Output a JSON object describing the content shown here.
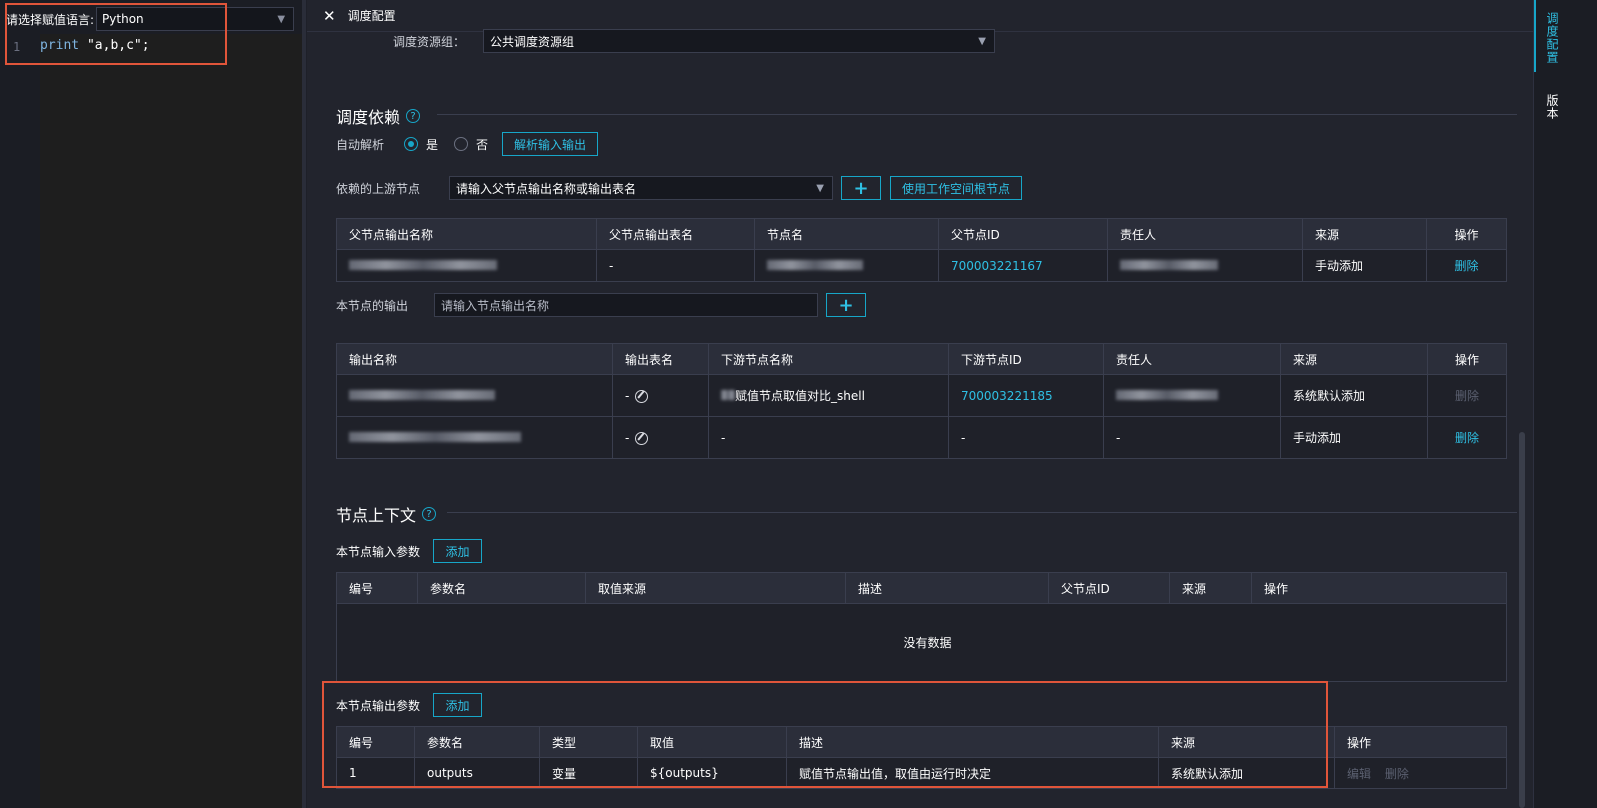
{
  "editor": {
    "lang_label": "请选择赋值语言:",
    "lang_value": "Python",
    "line_number": "1",
    "code_keyword": "print",
    "code_rest": " \"a,b,c\";"
  },
  "panel": {
    "title": "调度配置",
    "resource_group_label": "调度资源组：",
    "resource_group_value": "公共调度资源组",
    "dependency": {
      "title": "调度依赖",
      "auto_parse_label": "自动解析",
      "yes_label": "是",
      "no_label": "否",
      "parse_button": "解析输入输出",
      "upstream_label": "依赖的上游节点",
      "upstream_placeholder": "请输入父节点输出名称或输出表名",
      "root_node_button": "使用工作空间根节点",
      "upstream_table": {
        "headers": [
          "父节点输出名称",
          "父节点输出表名",
          "节点名",
          "父节点ID",
          "责任人",
          "来源",
          "操作"
        ],
        "rows": [
          {
            "output_table": "-",
            "node_id": "700003221167",
            "source": "手动添加",
            "action": "删除"
          }
        ]
      },
      "output_label": "本节点的输出",
      "output_placeholder": "请输入节点输出名称",
      "output_table": {
        "headers": [
          "输出名称",
          "输出表名",
          "下游节点名称",
          "下游节点ID",
          "责任人",
          "来源",
          "操作"
        ],
        "rows": [
          {
            "table_name": "-",
            "downstream_name": "赋值节点取值对比_shell",
            "downstream_id": "700003221185",
            "source": "系统默认添加",
            "action": "删除"
          },
          {
            "table_name": "-",
            "downstream_name": "-",
            "downstream_id": "-",
            "owner": "-",
            "source": "手动添加",
            "action": "删除"
          }
        ]
      }
    },
    "context": {
      "title": "节点上下文",
      "input_params_label": "本节点输入参数",
      "add_button": "添加",
      "input_table": {
        "headers": [
          "编号",
          "参数名",
          "取值来源",
          "描述",
          "父节点ID",
          "来源",
          "操作"
        ],
        "empty_text": "没有数据"
      },
      "output_params_label": "本节点输出参数",
      "output_table": {
        "headers": [
          "编号",
          "参数名",
          "类型",
          "取值",
          "描述",
          "来源",
          "操作"
        ],
        "rows": [
          {
            "no": "1",
            "name": "outputs",
            "type": "变量",
            "value": "${outputs}",
            "desc": "赋值节点输出值，取值由运行时决定",
            "source": "系统默认添加",
            "edit": "编辑",
            "delete": "删除"
          }
        ]
      }
    }
  },
  "side_tabs": {
    "config": "调度配置",
    "version": "版本"
  },
  "colors": {
    "accent": "#17a6c8",
    "highlight_box": "#e0553a",
    "background": "#22242d"
  }
}
